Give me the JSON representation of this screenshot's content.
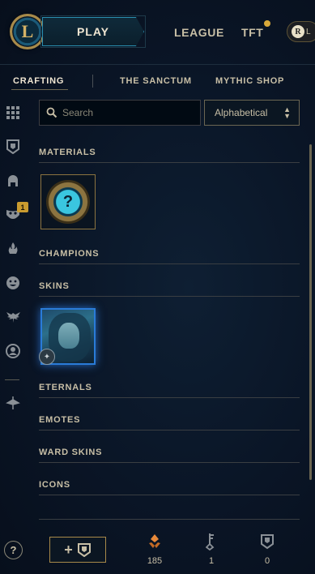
{
  "topbar": {
    "logo_glyph": "L",
    "play_label": "PLAY",
    "nav": [
      {
        "label": "LEAGUE"
      },
      {
        "label": "TFT"
      }
    ],
    "lor_badge": "R",
    "lor_letter": "L"
  },
  "tabs": [
    {
      "label": "CRAFTING",
      "active": true
    },
    {
      "label": "THE SANCTUM",
      "active": false
    },
    {
      "label": "MYTHIC SHOP",
      "active": false
    }
  ],
  "rail": {
    "icons": [
      "grid-icon",
      "ward-icon",
      "helmet-icon",
      "mask-icon",
      "flame-icon",
      "emote-face-icon",
      "wings-icon",
      "profile-icon",
      "arrow-emblem-icon"
    ],
    "badge_count": "1"
  },
  "search": {
    "placeholder": "Search",
    "value": ""
  },
  "sort": {
    "selected": "Alphabetical"
  },
  "sections": {
    "materials": "MATERIALS",
    "champions": "CHAMPIONS",
    "skins": "SKINS",
    "eternals": "ETERNALS",
    "emotes": "EMOTES",
    "ward_skins": "WARD SKINS",
    "icons": "ICONS"
  },
  "materials": {
    "mystery_glyph": "?"
  },
  "bottom": {
    "help_glyph": "?",
    "add_plus": "+",
    "currencies": [
      {
        "name": "orange-essence-icon",
        "value": "185"
      },
      {
        "name": "key-icon",
        "value": "1"
      },
      {
        "name": "ward-icon",
        "value": "0"
      }
    ]
  },
  "colors": {
    "background": "#0a1526",
    "gold": "#c8bfa6",
    "accent_blue": "#2a7bd8",
    "orange_essence": "#e8893a"
  }
}
